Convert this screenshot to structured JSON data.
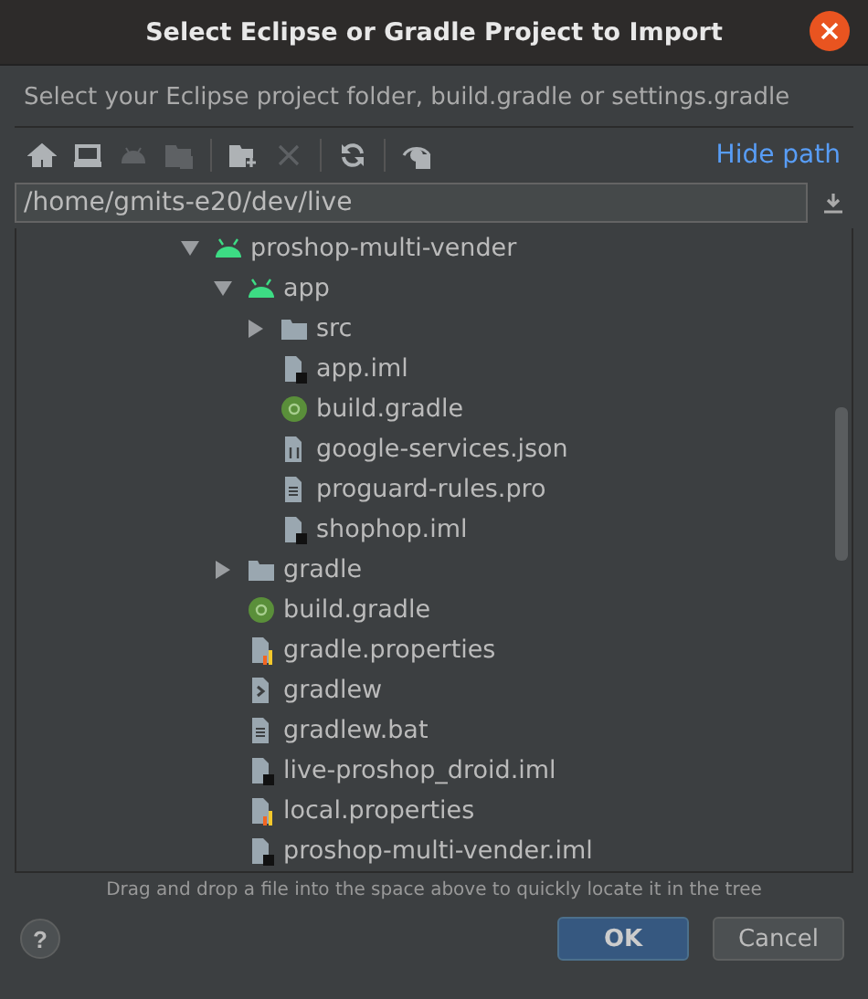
{
  "window": {
    "title": "Select Eclipse or Gradle Project to Import"
  },
  "description": "Select your Eclipse project folder, build.gradle or settings.gradle",
  "toolbar": [
    {
      "kind": "home",
      "disabled": false
    },
    {
      "kind": "desktop",
      "disabled": false
    },
    {
      "kind": "android",
      "disabled": true
    },
    {
      "kind": "module",
      "disabled": true
    },
    {
      "kind": "new-folder",
      "disabled": false
    },
    {
      "kind": "delete",
      "disabled": true
    },
    {
      "kind": "refresh",
      "disabled": false
    },
    {
      "kind": "hidden",
      "disabled": false
    }
  ],
  "hide_path_link": "Hide path",
  "path_field": {
    "value": "/home/gmits-e20/dev/live"
  },
  "tree": [
    {
      "label": "proshop-multi-vender",
      "kind": "android",
      "expanded": true,
      "children": [
        {
          "label": "app",
          "kind": "android",
          "expanded": true,
          "children": [
            {
              "label": "src",
              "kind": "folder",
              "expanded": false
            },
            {
              "label": "app.iml",
              "kind": "iml"
            },
            {
              "label": "build.gradle",
              "kind": "gradle"
            },
            {
              "label": "google-services.json",
              "kind": "json"
            },
            {
              "label": "proguard-rules.pro",
              "kind": "text"
            },
            {
              "label": "shophop.iml",
              "kind": "iml"
            }
          ]
        },
        {
          "label": "gradle",
          "kind": "folder",
          "expanded": false
        },
        {
          "label": "build.gradle",
          "kind": "gradle"
        },
        {
          "label": "gradle.properties",
          "kind": "properties"
        },
        {
          "label": "gradlew",
          "kind": "script"
        },
        {
          "label": "gradlew.bat",
          "kind": "text"
        },
        {
          "label": "live-proshop_droid.iml",
          "kind": "iml"
        },
        {
          "label": "local.properties",
          "kind": "properties"
        },
        {
          "label": "proshop-multi-vender.iml",
          "kind": "iml"
        }
      ]
    }
  ],
  "hint": "Drag and drop a file into the space above to quickly locate it in the tree",
  "help_button": "?",
  "buttons": [
    {
      "label": "OK",
      "kind": "primary"
    },
    {
      "label": "Cancel",
      "kind": "secondary"
    }
  ]
}
